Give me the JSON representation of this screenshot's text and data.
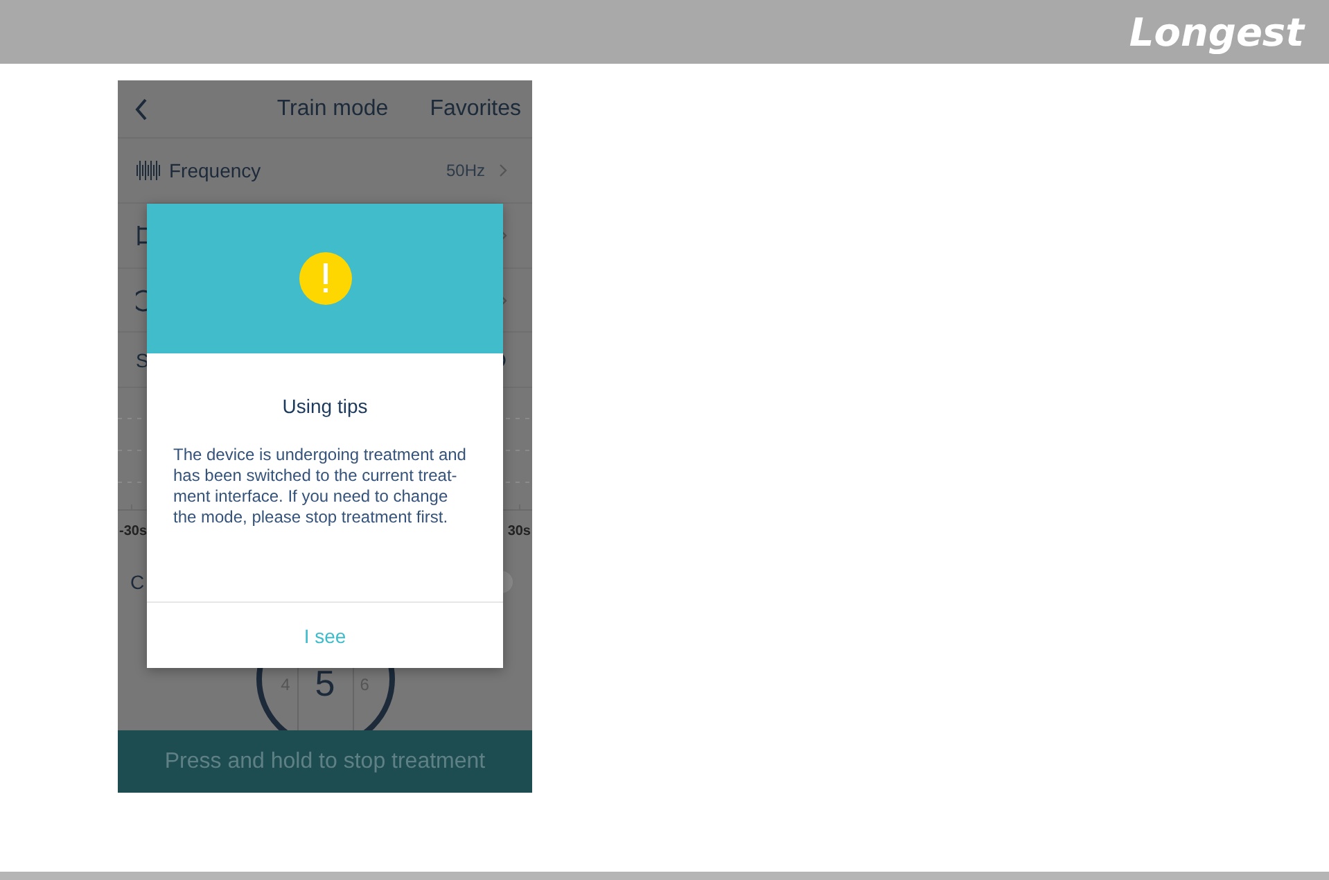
{
  "top_bar": {
    "logo": "Longest"
  },
  "screen": {
    "header": {
      "title": "Train mode",
      "action": "Favorites"
    },
    "rows": [
      {
        "kind": "frequency",
        "label": "Frequency",
        "value": "50Hz"
      },
      {
        "kind": "range"
      },
      {
        "kind": "timer"
      },
      {
        "kind": "settings",
        "label": "S"
      }
    ],
    "chart": {
      "start_label": "-30s",
      "end_label": "30s"
    },
    "toggle_row": {
      "label": "C",
      "on": false
    },
    "dial": [
      "4",
      "5",
      "6"
    ],
    "stop_button": "Press and hold to stop treatment"
  },
  "dialog": {
    "title": "Using tips",
    "message": "The device is undergoing treatment and\nhas been switched to the current treat-\nment interface. If you need to change\nthe mode, please stop treatment first.",
    "button": "I see"
  }
}
